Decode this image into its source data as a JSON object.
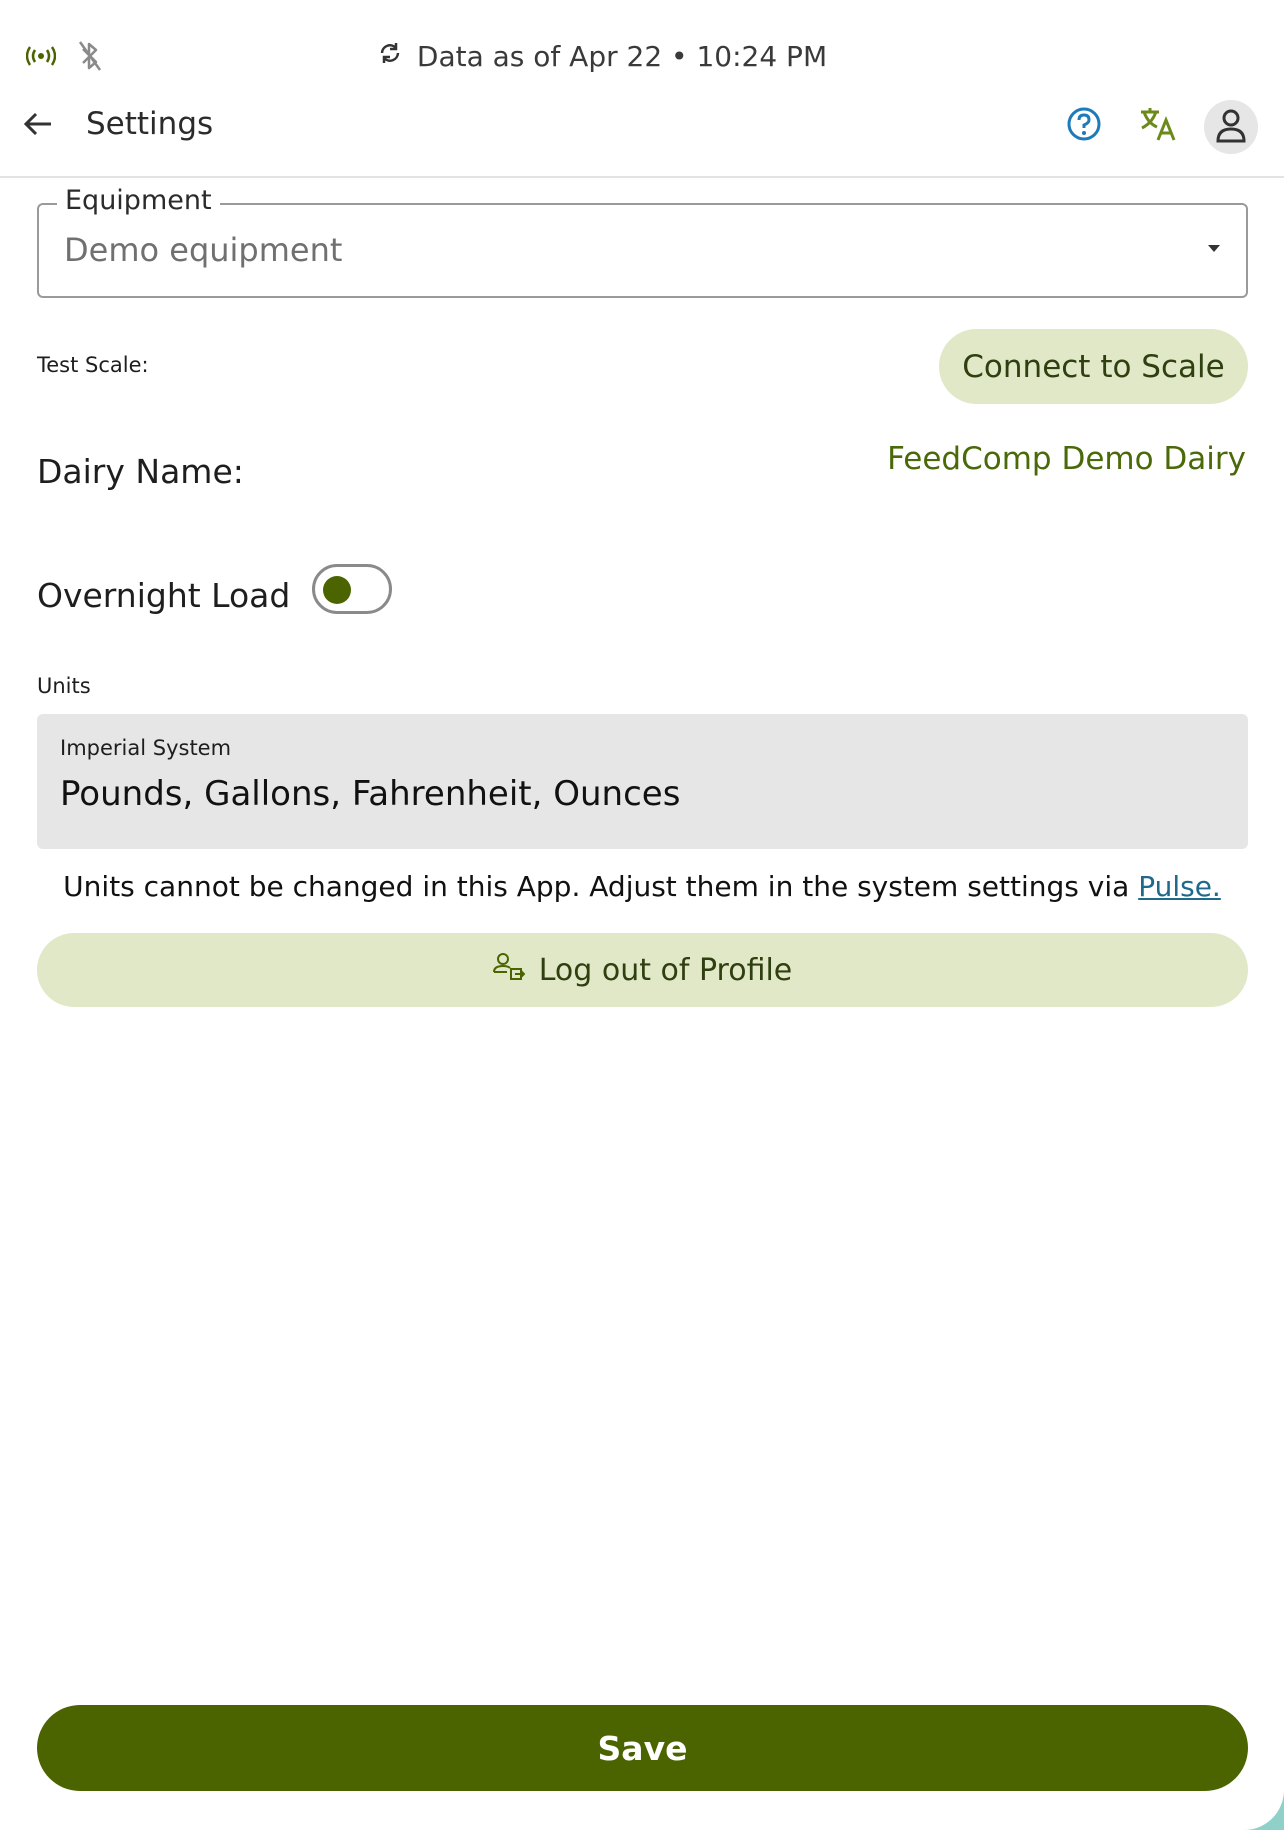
{
  "status": {
    "sync_text": "Data as of Apr 22 • 10:24 PM",
    "icons": [
      "broadcast-icon",
      "bluetooth-off-icon",
      "sync-icon"
    ]
  },
  "header": {
    "title": "Settings",
    "icons": [
      "back-arrow-icon",
      "help-icon",
      "translate-icon",
      "user-icon"
    ]
  },
  "equipment": {
    "label": "Equipment",
    "value": "Demo equipment"
  },
  "test_scale": {
    "label": "Test Scale:",
    "button_label": "Connect to Scale"
  },
  "dairy": {
    "label": "Dairy Name:",
    "value": "FeedComp Demo Dairy"
  },
  "overnight_load": {
    "label": "Overnight Load",
    "enabled": false
  },
  "units": {
    "label": "Units",
    "system": "Imperial System",
    "value": "Pounds, Gallons, Fahrenheit, Ounces",
    "note": "Units cannot be changed in this App. Adjust them in the system settings via",
    "link_label": "Pulse."
  },
  "logout": {
    "label": "Log out of Profile"
  },
  "save": {
    "label": "Save"
  },
  "colors": {
    "primary": "#4b6400",
    "accent_light": "#e0e8c8",
    "accent_text": "#4a6a0a",
    "link": "#1f6a8c",
    "help_icon": "#1e7ab8"
  }
}
